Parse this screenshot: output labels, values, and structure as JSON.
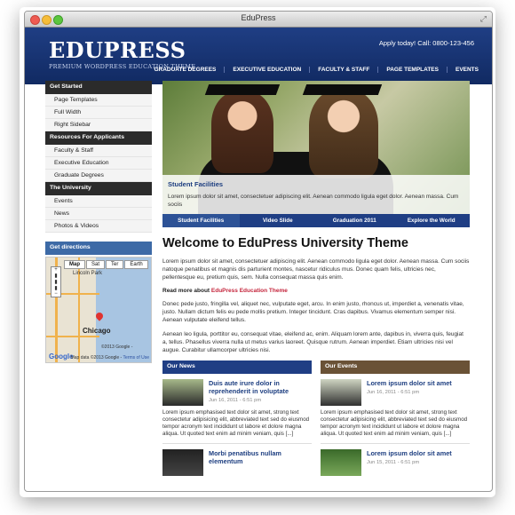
{
  "window": {
    "title": "EduPress"
  },
  "header": {
    "logo": "EDUPRESS",
    "tagline": "PREMIUM WORDPRESS EDUCATION THEME",
    "apply": "Apply today! Call: 0800-123-456",
    "nav": [
      "GRADUATE DEGREES",
      "EXECUTIVE EDUCATION",
      "FACULTY & STAFF",
      "PAGE TEMPLATES",
      "EVENTS"
    ]
  },
  "sidebar": {
    "sections": [
      {
        "heading": "Get Started",
        "items": [
          "Page Templates",
          "Full Width",
          "Right Sidebar"
        ]
      },
      {
        "heading": "Resources For Applicants",
        "items": [
          "Faculty & Staff",
          "Executive Education",
          "Graduate Degrees"
        ]
      },
      {
        "heading": "The University",
        "items": [
          "Events",
          "News",
          "Photos & Videos"
        ]
      }
    ],
    "map": {
      "heading": "Get directions",
      "tabs": [
        "Map",
        "Sat",
        "Ter",
        "Earth"
      ],
      "active_tab": "Map",
      "city": "Chicago",
      "labels": [
        "Lincoln Park"
      ],
      "copyright": "©2013 Google -",
      "footer": "Map data ©2013 Google -",
      "terms": "Terms of Use",
      "google": "Google"
    }
  },
  "slider": {
    "caption_title": "Student Facilities",
    "caption_text": "Lorem ipsum dolor sit amet, consectetuer adipiscing elit. Aenean commodo ligula eget dolor. Aenean massa. Cum sociis",
    "tabs": [
      "Student Facilities",
      "Video Slide",
      "Graduation 2011",
      "Explore the World"
    ],
    "active_tab": 0
  },
  "content": {
    "title": "Welcome to EduPress University Theme",
    "p1": "Lorem ipsum dolor sit amet, consectetuer adipiscing elit. Aenean commodo ligula eget dolor. Aenean massa. Cum sociis natoque penatibus et magnis dis parturient montes, nascetur ridiculus mus. Donec quam felis, ultricies nec, pellentesque eu, pretium quis, sem. Nulla consequat massa quis enim.",
    "readmore_prefix": "Read more about",
    "readmore_link": "EduPress Education Theme",
    "p2": "Donec pede justo, fringilla vel, aliquet nec, vulputate eget, arcu. In enim justo, rhoncus ut, imperdiet a, venenatis vitae, justo. Nullam dictum felis eu pede mollis pretium. Integer tincidunt. Cras dapibus. Vivamus elementum semper nisi. Aenean vulputate eleifend tellus.",
    "p3": "Aenean leo ligula, porttitor eu, consequat vitae, eleifend ac, enim. Aliquam lorem ante, dapibus in, viverra quis, feugiat a, tellus. Phasellus viverra nulla ut metus varius laoreet. Quisque rutrum. Aenean imperdiet. Etiam ultricies nisi vel augue. Curabitur ullamcorper ultricies nisi."
  },
  "news": {
    "heading": "Our News",
    "items": [
      {
        "title": "Duis aute irure dolor in reprehenderit in voluptate",
        "date": "Jun 16, 2011 - 6:51 pm",
        "text": "Lorem ipsum emphasised text dolor sit amet, strong text consectetur adipisicing elit, abbreviated text sed do eiusmod tempor acronym text incididunt ut labore et dolore magna aliqua. Ut quoted text enim ad minim veniam, quis [...]"
      },
      {
        "title": "Morbi penatibus nullam elementum",
        "date": "",
        "text": ""
      }
    ]
  },
  "events": {
    "heading": "Our Events",
    "items": [
      {
        "title": "Lorem ipsum dolor sit amet",
        "date": "Jun 16, 2011 - 6:51 pm",
        "text": "Lorem ipsum emphasised text dolor sit amet, strong text consectetur adipisicing elit, abbreviated text sed do eiusmod tempor acronym text incididunt ut labore et dolore magna aliqua. Ut quoted text enim ad minim veniam, quis [...]"
      },
      {
        "title": "Lorem ipsum dolor sit amet",
        "date": "Jun 15, 2011 - 6:51 pm",
        "text": ""
      }
    ]
  },
  "colors": {
    "brand": "#1f3e84",
    "accent": "#c4243b",
    "events": "#6a5236"
  }
}
